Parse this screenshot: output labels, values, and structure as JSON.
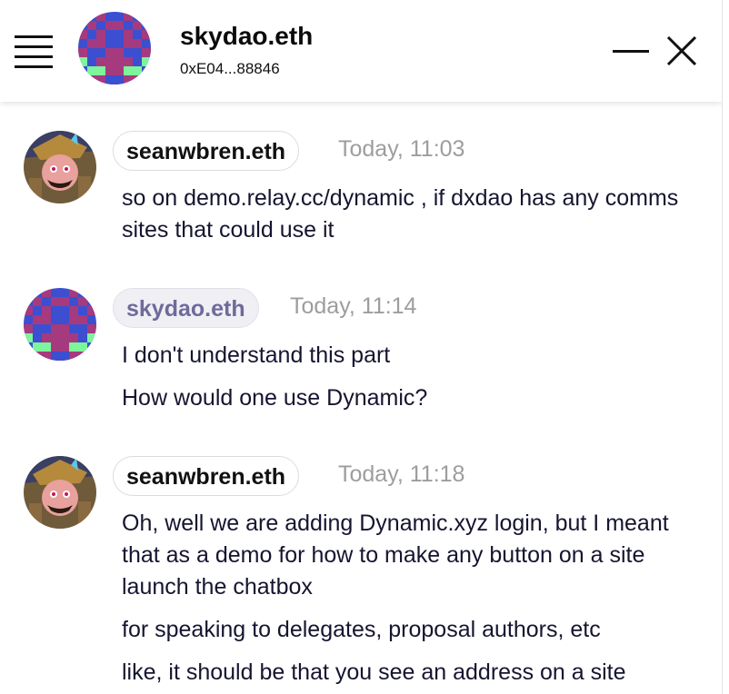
{
  "header": {
    "name": "skydao.eth",
    "address": "0xE04...88846"
  },
  "messages": [
    {
      "sender": "seanwbren.eth",
      "time": "Today, 11:03",
      "lines": [
        "so on demo.relay.cc/dynamic , if dxdao has any comms sites that could use it"
      ]
    },
    {
      "sender": "skydao.eth",
      "time": "Today, 11:14",
      "lines": [
        "I don't understand this part",
        "How would one use Dynamic?"
      ]
    },
    {
      "sender": "seanwbren.eth",
      "time": "Today, 11:18",
      "lines": [
        "Oh, well we are adding Dynamic.xyz login, but I meant that as a demo for how to make any button on a site launch the chatbox",
        "for speaking to delegates, proposal authors, etc",
        "like, it should be that you see an address on a site"
      ]
    }
  ],
  "icons": {
    "menu": "hamburger-menu-icon",
    "minimize": "minimize-icon",
    "close": "close-icon"
  },
  "colors": {
    "avatar_blue": "#3b4fd0",
    "avatar_magenta": "#a63a7e",
    "avatar_green": "#7cf59b",
    "self_pill_text": "#6e6a9a",
    "timestamp": "#9d9d9d"
  }
}
